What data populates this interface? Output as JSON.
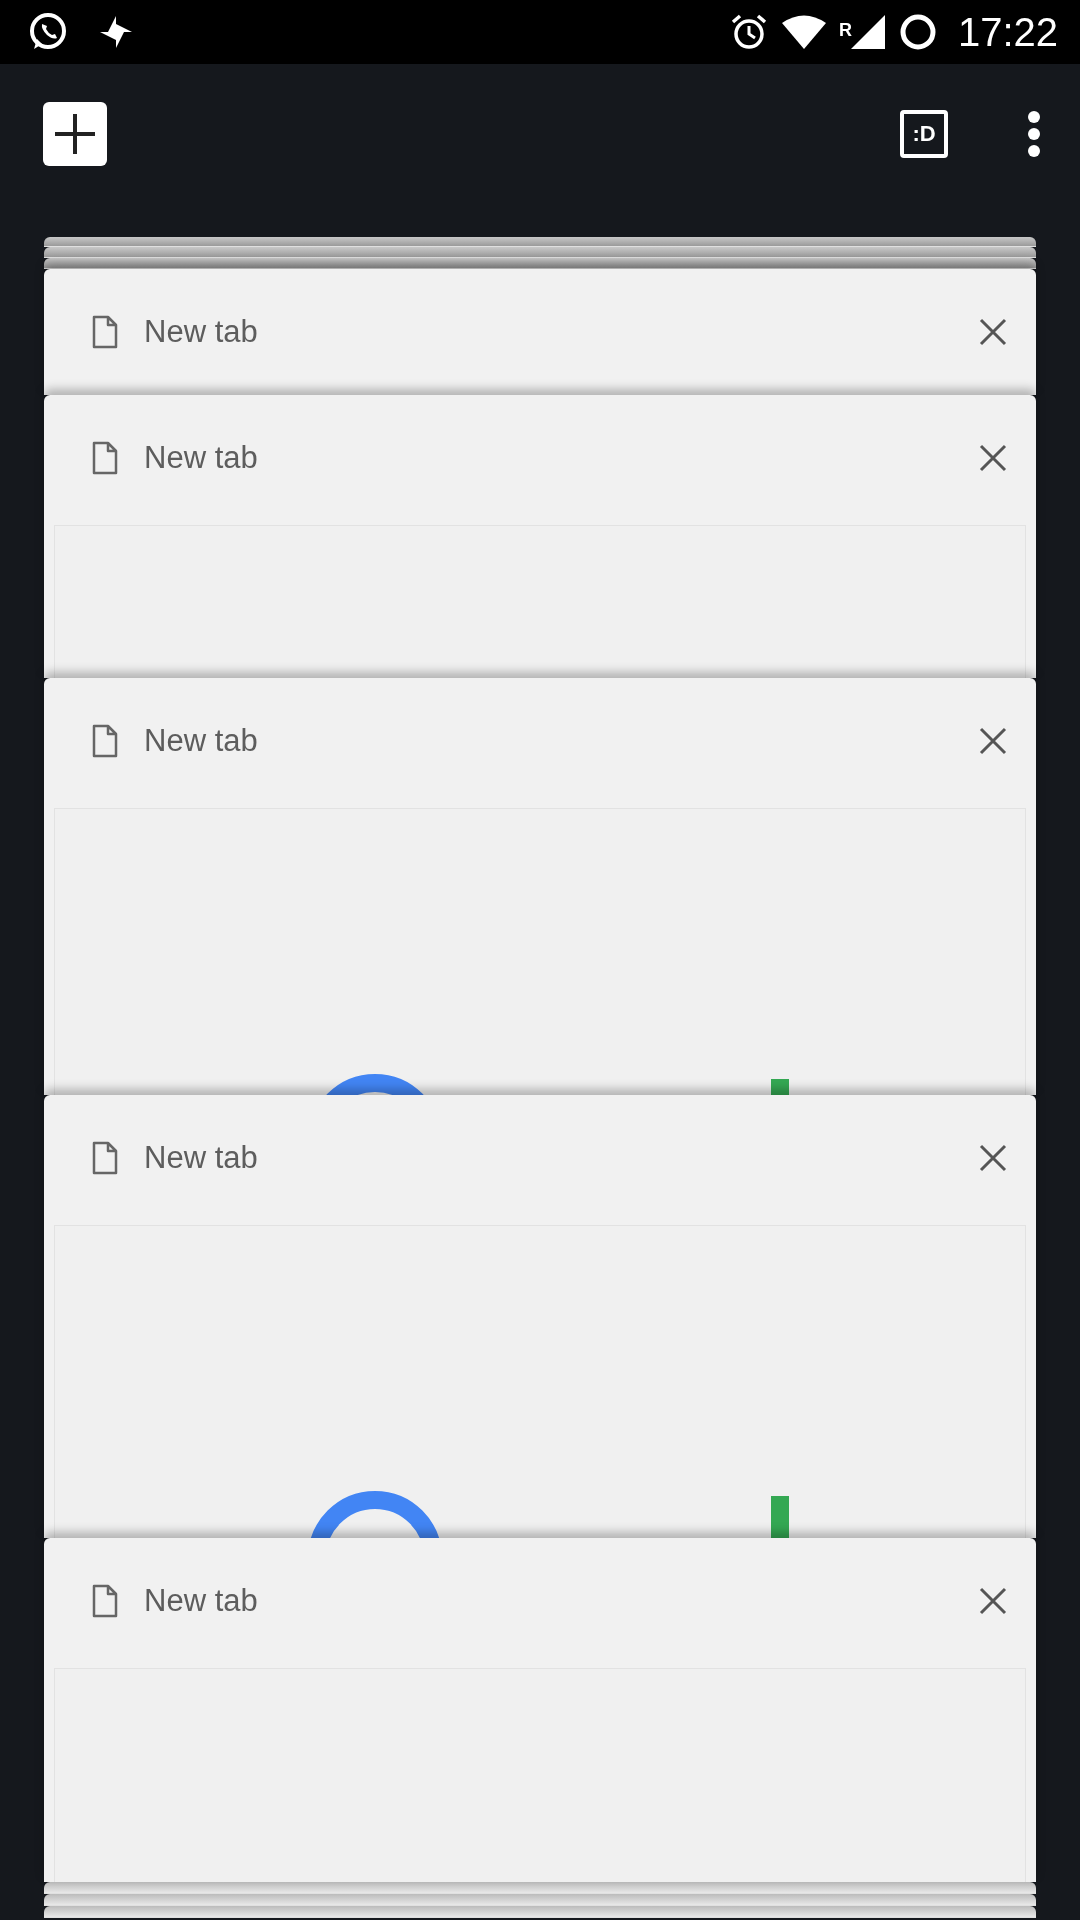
{
  "status_bar": {
    "roaming": "R",
    "time": "17:22"
  },
  "toolbar": {
    "incognito_label": ":D"
  },
  "tabs": [
    {
      "title": "New tab"
    },
    {
      "title": "New tab"
    },
    {
      "title": "New tab"
    },
    {
      "title": "New tab"
    },
    {
      "title": "New tab"
    }
  ]
}
